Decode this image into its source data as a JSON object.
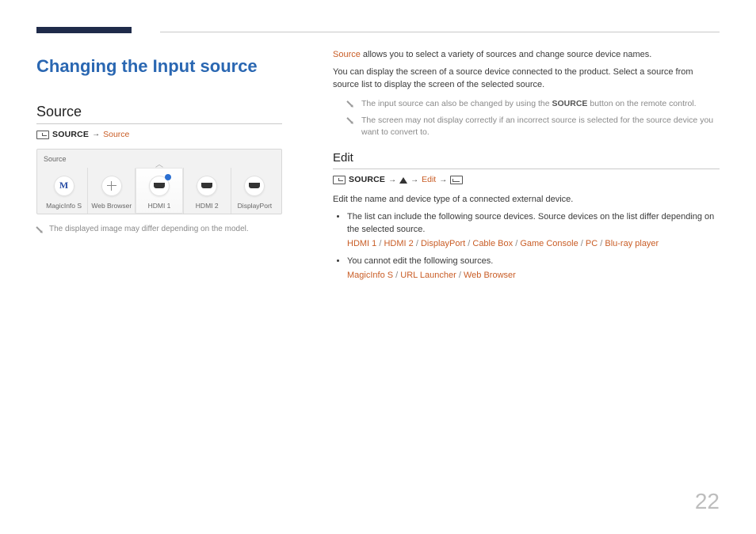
{
  "page_number": "22",
  "title": "Changing the Input source",
  "left": {
    "heading": "Source",
    "nav": {
      "source_label": "SOURCE",
      "source_target": "Source"
    },
    "selector": {
      "title": "Source",
      "items": [
        {
          "label": "MagicInfo S"
        },
        {
          "label": "Web Browser"
        },
        {
          "label": "HDMI 1",
          "selected": true
        },
        {
          "label": "HDMI 2"
        },
        {
          "label": "DisplayPort"
        }
      ]
    },
    "note": "The displayed image may differ depending on the model."
  },
  "right": {
    "intro_strong": "Source",
    "intro_rest": " allows you to select a variety of sources and change source device names.",
    "intro2": "You can display the screen of a source device connected to the product. Select a source from source list to display the screen of the selected source.",
    "notes": [
      {
        "pre": "The input source can also be changed by using the ",
        "bold": "SOURCE",
        "post": " button on the remote control."
      },
      {
        "pre": "The screen may not display correctly if an incorrect source is selected for the source device you want to convert to.",
        "bold": "",
        "post": ""
      }
    ],
    "edit": {
      "heading": "Edit",
      "nav": {
        "source_label": "SOURCE",
        "edit_label": "Edit"
      },
      "line": "Edit the name and device type of a connected external device.",
      "bullets": [
        {
          "text": "The list can include the following source devices. Source devices on the list differ depending on the selected source.",
          "items": [
            "HDMI 1",
            "HDMI 2",
            "DisplayPort",
            "Cable Box",
            "Game Console",
            "PC",
            "Blu-ray player"
          ]
        },
        {
          "text": "You cannot edit the following sources.",
          "items": [
            "MagicInfo S",
            "URL Launcher",
            "Web Browser"
          ]
        }
      ]
    }
  }
}
